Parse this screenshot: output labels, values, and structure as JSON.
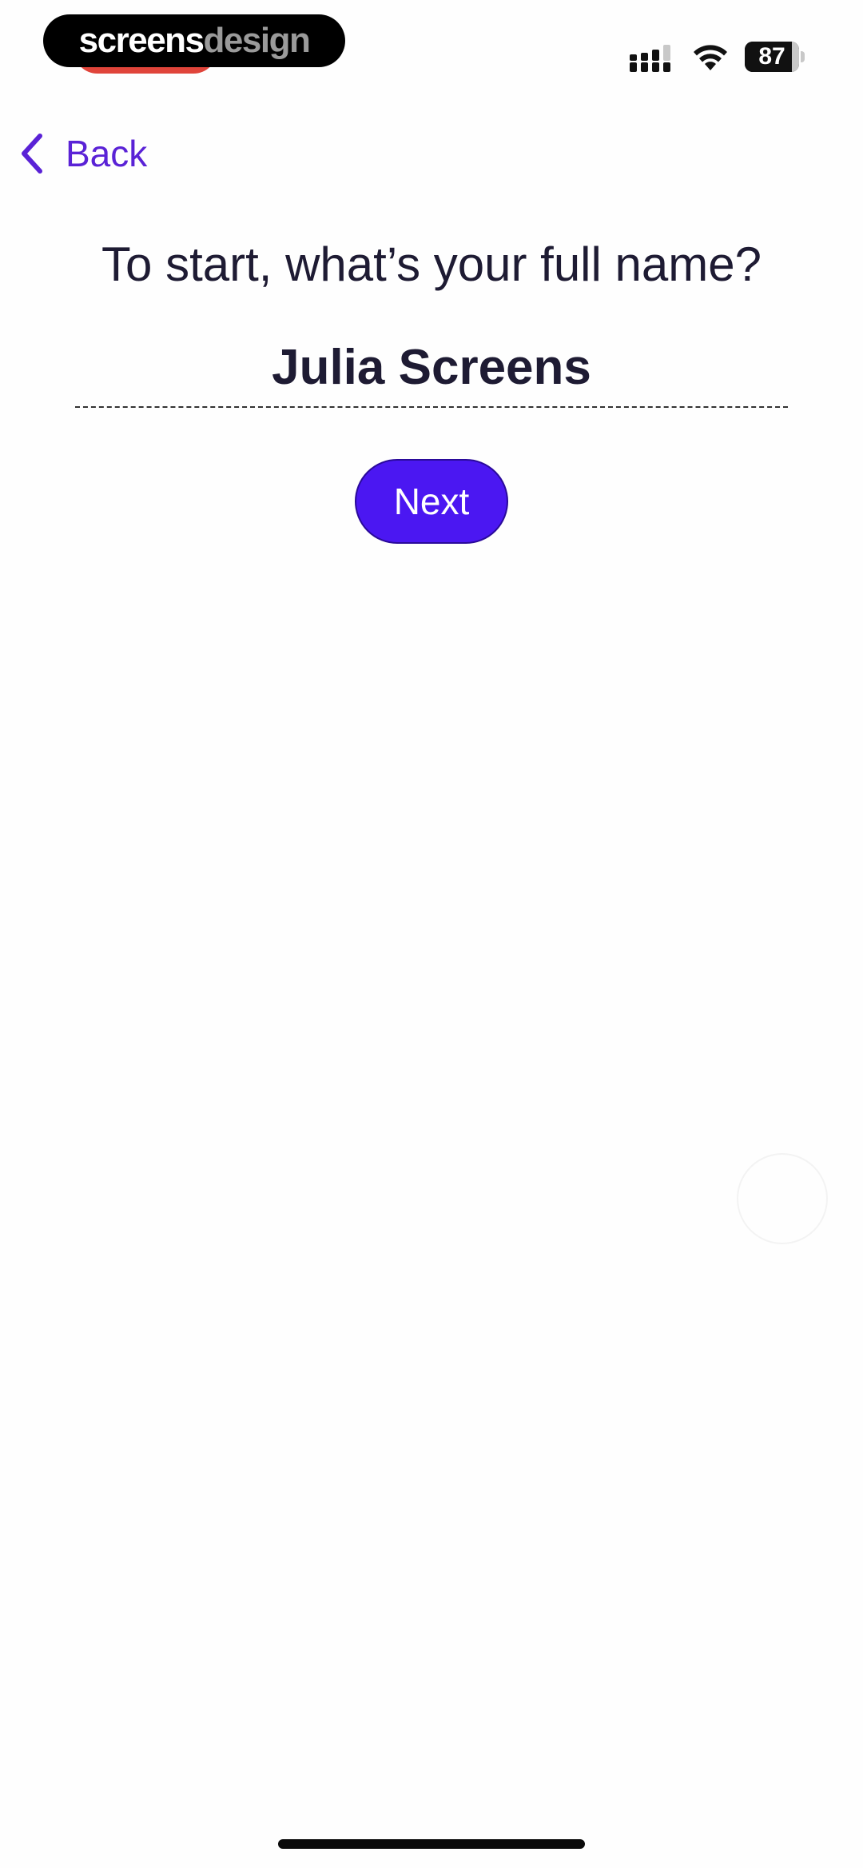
{
  "watermark": {
    "part1": "screens",
    "part2": "design"
  },
  "status_bar": {
    "battery_percent": "87",
    "battery_level": 0.87,
    "icons": [
      "signal-icon",
      "wifi-icon",
      "battery-icon"
    ]
  },
  "nav": {
    "back_label": "Back",
    "back_icon": "chevron-left-icon"
  },
  "form": {
    "question": "To start, what’s your full name?",
    "name_value": "Julia Screens",
    "next_label": "Next"
  },
  "colors": {
    "accent": "#4b17f2",
    "back_link": "#5a22d6",
    "text": "#1e1b33",
    "status_red": "#e0443a"
  }
}
